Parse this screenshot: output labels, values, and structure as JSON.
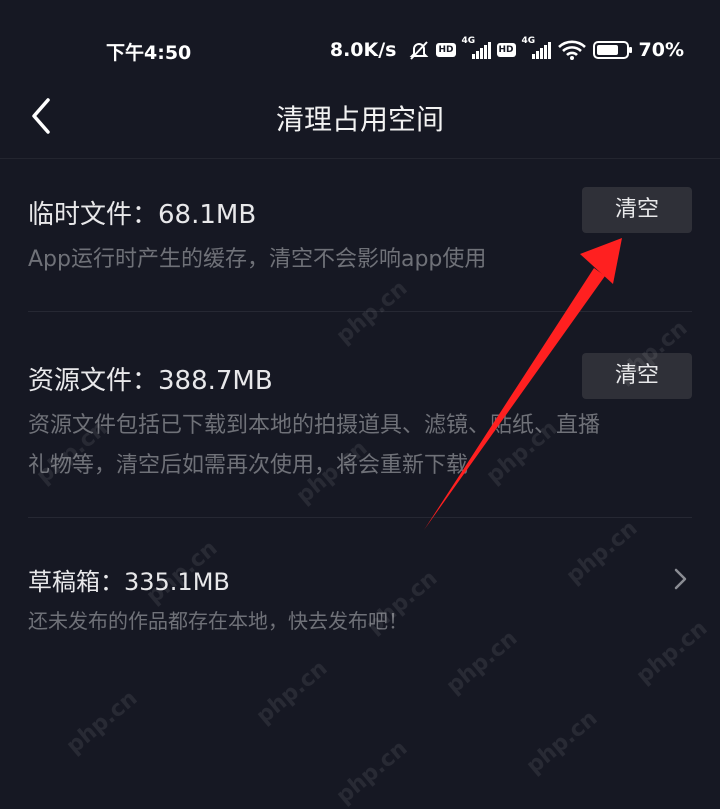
{
  "status_bar": {
    "time": "下午4:50",
    "net_speed": "8.0K/s",
    "hd_label": "HD",
    "network_label": "4G",
    "battery_percent": "70%",
    "icons": [
      "mute-icon",
      "signal-icon",
      "wifi-icon",
      "battery-icon"
    ]
  },
  "nav": {
    "title": "清理占用空间",
    "back_icon": "chevron-left-icon"
  },
  "items": [
    {
      "title": "临时文件：68.1MB",
      "description": "App运行时产生的缓存，清空不会影响app使用",
      "button_label": "清空"
    },
    {
      "title": "资源文件：388.7MB",
      "description_line1": "资源文件包括已下载到本地的拍摄道具、滤镜、贴纸、直播",
      "description_line2": "礼物等，清空后如需再次使用，将会重新下载",
      "button_label": "清空"
    },
    {
      "title": "草稿箱：335.1MB",
      "description": "还未发布的作品都存在本地，快去发布吧！",
      "chevron_icon": "chevron-right-icon"
    }
  ],
  "watermark_text": "php.cn",
  "annotation_color": "#ff2020"
}
